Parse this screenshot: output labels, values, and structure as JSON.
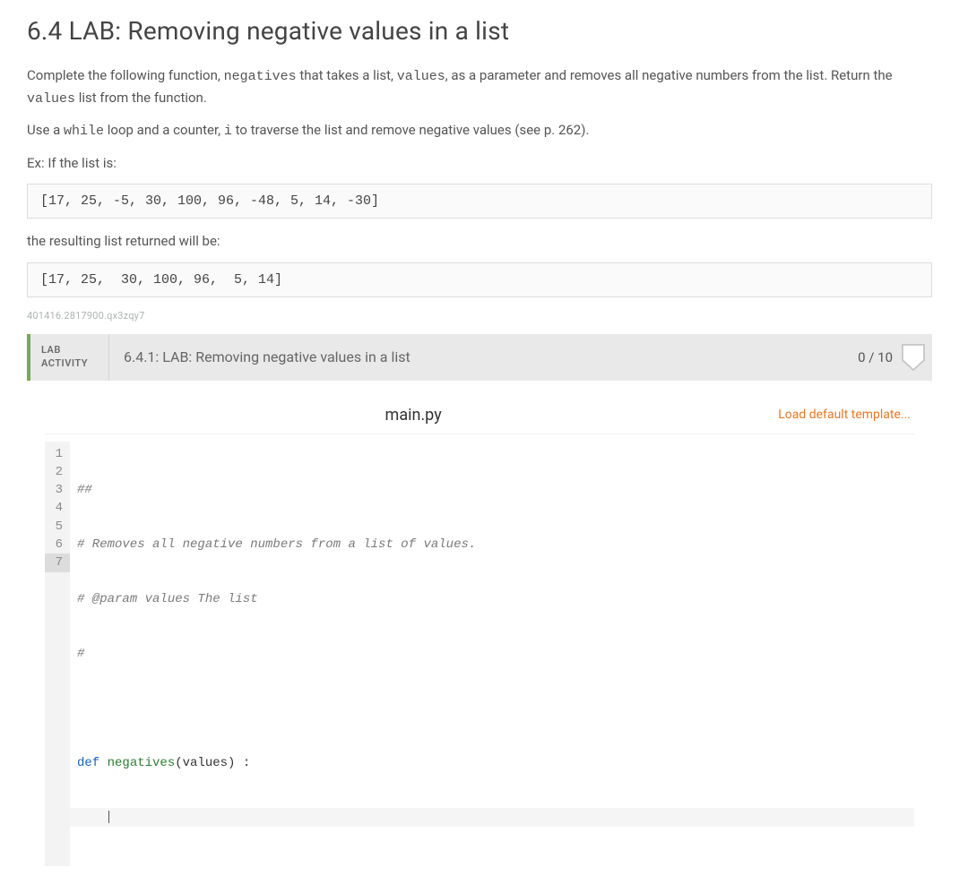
{
  "heading": "6.4 LAB: Removing negative values in a list",
  "intro": {
    "p1_a": "Complete the following function, ",
    "p1_code1": "negatives",
    "p1_b": " that takes a list, ",
    "p1_code2": "values",
    "p1_c": ", as a parameter and removes all negative numbers from the list. Return the ",
    "p1_code3": "values",
    "p1_d": " list from the function.",
    "p2_a": "Use a ",
    "p2_code1": "while",
    "p2_b": " loop and a counter, ",
    "p2_code2": "i",
    "p2_c": " to traverse the list and remove negative values (see p. 262).",
    "p3": "Ex: If the list is:"
  },
  "example_input": "[17, 25, -5, 30, 100, 96, -48, 5, 14, -30]",
  "result_label": "the resulting list returned will be:",
  "example_output": "[17, 25,  30, 100, 96,  5, 14]",
  "tiny_id": "401416.2817900.qx3zqy7",
  "activity": {
    "badge_line1": "LAB",
    "badge_line2": "ACTIVITY",
    "title": "6.4.1: LAB: Removing negative values in a list",
    "score": "0 / 10"
  },
  "editor": {
    "filename": "main.py",
    "load_template_label": "Load default template...",
    "lines": {
      "l1_num": "1",
      "l1": "##",
      "l2_num": "2",
      "l2": "# Removes all negative numbers from a list of values.",
      "l3_num": "3",
      "l3": "# @param values The list",
      "l4_num": "4",
      "l4": "#",
      "l5_num": "5",
      "l6_num": "6",
      "l6_kw": "def ",
      "l6_fn": "negatives",
      "l6_rest": "(values) :",
      "l7_num": "7"
    }
  }
}
